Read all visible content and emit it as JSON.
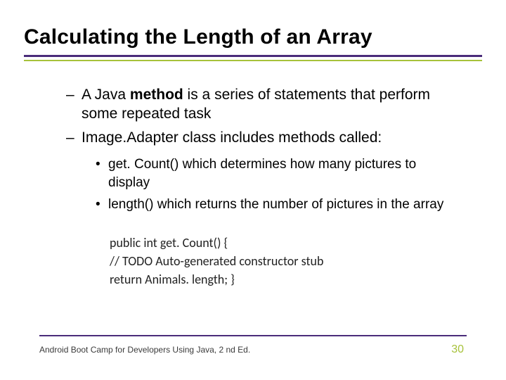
{
  "title": "Calculating the Length of an Array",
  "bullets": {
    "dash": [
      {
        "pre": "A Java ",
        "bold": "method",
        "post": " is a series of statements that perform some repeated task"
      },
      {
        "pre": "Image.Adapter class includes methods called:",
        "bold": "",
        "post": ""
      }
    ],
    "dot": [
      "get. Count() which determines how many pictures to display",
      "length() which returns the number of pictures in the array"
    ]
  },
  "code": {
    "line1": "public int get. Count() {",
    "line2": "// TODO Auto-generated constructor stub",
    "line3": "return Animals. length; }"
  },
  "footer": {
    "text": "Android Boot Camp for Developers Using Java, 2 nd Ed.",
    "page": "30"
  }
}
